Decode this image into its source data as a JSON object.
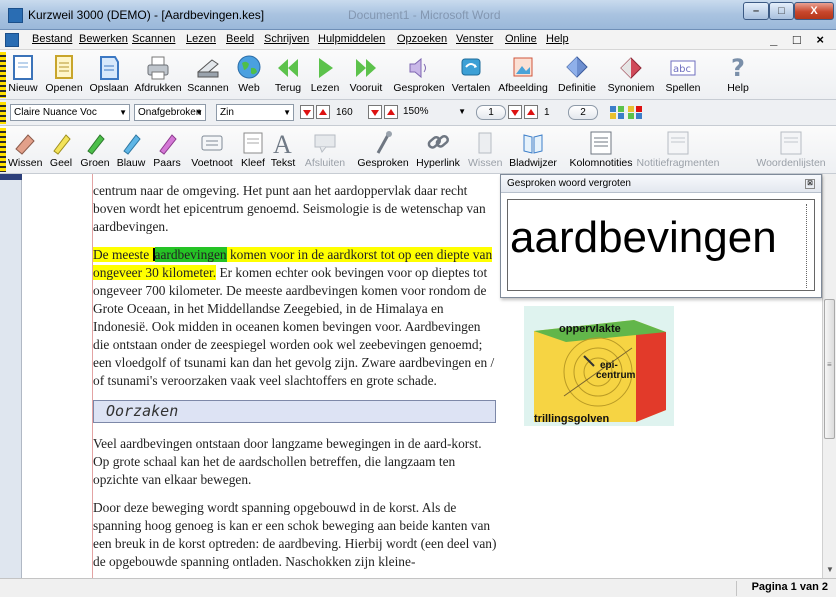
{
  "window": {
    "title": "Kurzweil 3000 (DEMO) - [Aardbevingen.kes]",
    "background_title": "Document1 - Microsoft Word"
  },
  "menu": [
    "Bestand",
    "Bewerken",
    "Scannen",
    "Lezen",
    "Beeld",
    "Schrijven",
    "Hulpmiddelen",
    "Opzoeken",
    "Venster",
    "Online",
    "Help"
  ],
  "toolbar_main": [
    {
      "label": "Nieuw",
      "icon": "new-document-icon"
    },
    {
      "label": "Openen",
      "icon": "open-document-icon"
    },
    {
      "label": "Opslaan",
      "icon": "save-icon"
    },
    {
      "label": "Afdrukken",
      "icon": "printer-icon"
    },
    {
      "label": "Scannen",
      "icon": "scanner-icon"
    },
    {
      "label": "Web",
      "icon": "globe-icon"
    },
    {
      "label": "Terug",
      "icon": "back-icon"
    },
    {
      "label": "Lezen",
      "icon": "play-icon"
    },
    {
      "label": "Vooruit",
      "icon": "forward-icon"
    },
    {
      "label": "Gesproken",
      "icon": "speaker-icon"
    },
    {
      "label": "Vertalen",
      "icon": "translate-icon"
    },
    {
      "label": "Afbeelding",
      "icon": "image-icon"
    },
    {
      "label": "Definitie",
      "icon": "definition-icon"
    },
    {
      "label": "Synoniem",
      "icon": "synonym-icon"
    },
    {
      "label": "Spellen",
      "icon": "spell-icon"
    },
    {
      "label": "Help",
      "icon": "help-icon"
    }
  ],
  "toolbar_reading": {
    "voice": "Claire Nuance Voc",
    "mode": "Onafgebroken",
    "unit": "Zin",
    "speed": "160",
    "zoom": "150%",
    "step1": "1",
    "step2": "1",
    "step3": "2"
  },
  "toolbar_study": [
    {
      "label": "Wissen",
      "icon": "eraser-icon",
      "enabled": true
    },
    {
      "label": "Geel",
      "icon": "yellow-highlighter-icon",
      "enabled": true
    },
    {
      "label": "Groen",
      "icon": "green-highlighter-icon",
      "enabled": true
    },
    {
      "label": "Blauw",
      "icon": "blue-highlighter-icon",
      "enabled": true
    },
    {
      "label": "Paars",
      "icon": "purple-highlighter-icon",
      "enabled": true
    },
    {
      "label": "Voetnoot",
      "icon": "footnote-icon",
      "enabled": true
    },
    {
      "label": "Kleef",
      "icon": "sticky-note-icon",
      "enabled": true
    },
    {
      "label": "Tekst",
      "icon": "text-icon",
      "enabled": true
    },
    {
      "label": "Afsluiten",
      "icon": "close-note-icon",
      "enabled": false
    },
    {
      "label": "Gesproken",
      "icon": "voice-note-icon",
      "enabled": true
    },
    {
      "label": "Hyperlink",
      "icon": "hyperlink-icon",
      "enabled": true
    },
    {
      "label": "Wissen",
      "icon": "clear-icon",
      "enabled": false
    },
    {
      "label": "Bladwijzer",
      "icon": "bookmark-icon",
      "enabled": true
    },
    {
      "label": "Kolomnotities",
      "icon": "column-notes-icon",
      "enabled": true
    },
    {
      "label": "Notitiefragmenten",
      "icon": "note-fragments-icon",
      "enabled": false
    },
    {
      "label": "Woordenlijsten",
      "icon": "word-list-icon",
      "enabled": false
    }
  ],
  "document": {
    "p1": "centrum naar de omgeving. Het punt aan het aardoppervlak daar recht boven wordt het epicentrum genoemd. Seismologie is de wetenschap van aardbevingen.",
    "p2_hl_before": "De meeste ",
    "p2_hl_word": "aardbevingen",
    "p2_hl_after": " komen voor in de aardkorst tot op een diepte van ongeveer 30 kilometer.",
    "p2_rest": " Er komen echter ook bevingen voor op dieptes tot ongeveer 700 kilometer. De meeste aardbevingen komen voor rondom de Grote Oceaan, in het Middellandse Zeegebied, in de Himalaya en Indonesië. Ook midden in oceanen komen bevingen voor. Aardbevingen die ontstaan onder de zeespiegel worden ook wel zeebevingen genoemd; een vloedgolf of tsunami kan dan het gevolg zijn. Zware aardbevingen en / of tsunami's veroorzaken vaak veel slachtoffers en grote schade.",
    "heading": "Oorzaken",
    "p3": "Veel aardbevingen ontstaan door langzame bewegingen in de aard-korst. Op grote schaal kan het de aardschollen betreffen, die langzaam ten opzichte van elkaar bewegen.",
    "p4": "Door deze beweging wordt spanning opgebouwd in de korst. Als de spanning hoog genoeg is kan er een schok beweging aan beide kanten van een breuk in de korst optreden: de aardbeving. Hierbij wordt (een deel van) de opgebouwde spanning ontladen. Naschokken zijn kleine-"
  },
  "figure": {
    "label_top": "oppervlakte",
    "label_epi": "epi-",
    "label_centrum": "centrum",
    "label_bottom": "trillingsgolven"
  },
  "popup": {
    "title": "Gesproken woord vergroten",
    "word": "aardbevingen"
  },
  "status": {
    "page": "Pagina 1 van 2"
  },
  "colors": {
    "highlight_yellow": "#ffff00",
    "highlight_green": "#25c325"
  }
}
